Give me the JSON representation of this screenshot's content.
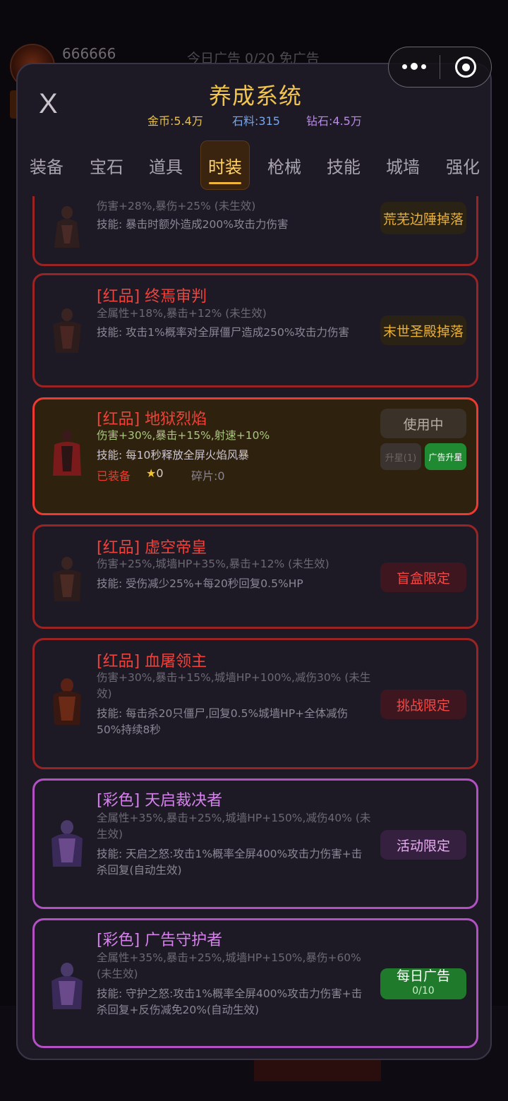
{
  "background": {
    "player_name": "666666",
    "ad_text": "今日广告 0/20 免广告"
  },
  "modal": {
    "close_label": "X",
    "title": "养成系统",
    "resources": {
      "gold": "金币:5.4万",
      "stone": "石料:315",
      "diamond": "钻石:4.5万"
    },
    "tabs": [
      "装备",
      "宝石",
      "道具",
      "时装",
      "枪械",
      "技能",
      "城墙",
      "强化"
    ],
    "active_tab": "时装"
  },
  "cards": [
    {
      "name": "",
      "attr": "伤害+28%,暴伤+25% (未生效)",
      "skill": "技能: 暴击时额外造成200%攻击力伤害",
      "action": "荒芜边陲掉落"
    },
    {
      "name": "[红品] 终焉审判",
      "attr": "全属性+18%,暴击+12% (未生效)",
      "skill": "技能: 攻击1%概率对全屏僵尸造成250%攻击力伤害",
      "action": "末世圣殿掉落"
    },
    {
      "name": "[红品] 地狱烈焰",
      "attr": "伤害+30%,暴击+15%,射速+10%",
      "skill": "技能: 每10秒释放全屏火焰风暴",
      "equipped_label": "已装备",
      "star_icon": "★",
      "stars": "0",
      "fragments": "碎片:0",
      "action": "使用中",
      "star_up": "升星(1)",
      "ad_star_up": "广告升星"
    },
    {
      "name": "[红品] 虚空帝皇",
      "attr": "伤害+25%,城墙HP+35%,暴击+12% (未生效)",
      "skill": "技能: 受伤减少25%+每20秒回复0.5%HP",
      "action": "盲盒限定"
    },
    {
      "name": "[红品] 血屠领主",
      "attr": "伤害+30%,暴击+15%,城墙HP+100%,减伤30% (未生效)",
      "skill": "技能: 每击杀20只僵尸,回复0.5%城墙HP+全体减伤50%持续8秒",
      "action": "挑战限定"
    },
    {
      "name": "[彩色] 天启裁决者",
      "attr": "全属性+35%,暴击+25%,城墙HP+150%,减伤40% (未生效)",
      "skill": "技能: 天启之怒:攻击1%概率全屏400%攻击力伤害+击杀回复(自动生效)",
      "action": "活动限定"
    },
    {
      "name": "[彩色] 广告守护者",
      "attr": "全属性+35%,暴击+25%,城墙HP+150%,暴伤+60% (未生效)",
      "skill": "技能: 守护之怒:攻击1%概率全屏400%攻击力伤害+击杀回复+反伤减免20%(自动生效)",
      "action": "每日广告",
      "action_sub": "0/10"
    }
  ],
  "colors": {
    "gold": "#f0c44d",
    "red_border": "#9a2424",
    "equipped_border": "#ef3a32",
    "rainbow_border": "#b350c4",
    "green_button": "#1f7a2c"
  }
}
